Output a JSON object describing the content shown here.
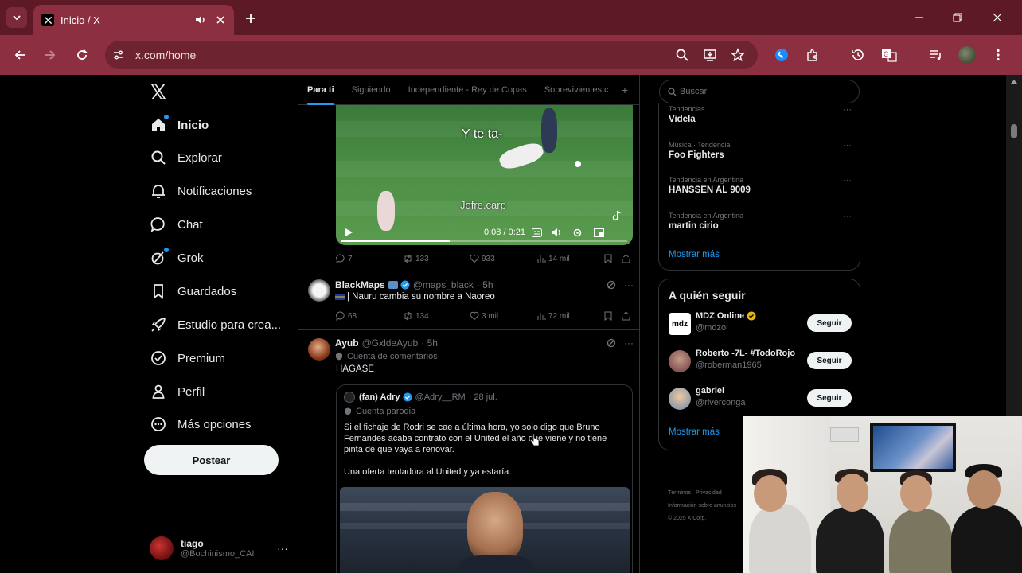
{
  "browser": {
    "tab_title": "Inicio / X",
    "url": "x.com/home"
  },
  "sidebar": {
    "items": [
      {
        "label": "Inicio",
        "icon": "home-icon"
      },
      {
        "label": "Explorar",
        "icon": "search-icon"
      },
      {
        "label": "Notificaciones",
        "icon": "bell-icon"
      },
      {
        "label": "Chat",
        "icon": "chat-bubble-icon"
      },
      {
        "label": "Grok",
        "icon": "grok-icon"
      },
      {
        "label": "Guardados",
        "icon": "bookmark-icon"
      },
      {
        "label": "Estudio para crea...",
        "icon": "rocket-icon"
      },
      {
        "label": "Premium",
        "icon": "premium-icon"
      },
      {
        "label": "Perfil",
        "icon": "person-icon"
      },
      {
        "label": "Más opciones",
        "icon": "more-circle-icon"
      }
    ],
    "post_button": "Postear",
    "account": {
      "name": "tiago",
      "handle": "@Bochinismo_CAI"
    }
  },
  "timeline": {
    "tabs": [
      "Para ti",
      "Siguiendo",
      "Independiente - Rey de Copas",
      "Sobrevivientes c"
    ],
    "video": {
      "caption": "Y te ta-",
      "watermark": "Jofre.carp",
      "time": "0:08 / 0:21",
      "progress": 0.38,
      "stats": {
        "replies": "7",
        "reposts": "133",
        "likes": "933",
        "views": "14 mil"
      }
    },
    "tweets": [
      {
        "name": "BlackMaps",
        "handle": "@maps_black",
        "time": "· 5h",
        "text": "| Nauru cambia su nombre a Naoreo",
        "stats": {
          "replies": "68",
          "reposts": "134",
          "likes": "3 mil",
          "views": "72 mil"
        }
      },
      {
        "name": "Ayub",
        "handle": "@GxldeAyub",
        "time": "· 5h",
        "community": "Cuenta de comentarios",
        "text": "HAGASE",
        "quote": {
          "name": "(fan) Adry",
          "handle": "@Adry__RM",
          "time": "· 28 jul.",
          "community": "Cuenta parodia",
          "text": "Si el fichaje de Rodri se cae a última hora, yo solo digo que Bruno Fernandes acaba contrato con el United el año que viene y no tiene pinta de que vaya a renovar.",
          "text2": "Una oferta tentadora al United y ya estaría."
        }
      }
    ]
  },
  "right": {
    "search_placeholder": "Buscar",
    "trends": [
      {
        "meta": "Tendencias",
        "name": "Videla"
      },
      {
        "meta": "Música · Tendencia",
        "name": "Foo Fighters"
      },
      {
        "meta": "Tendencia en Argentina",
        "name": "HANSSEN AL 9009"
      },
      {
        "meta": "Tendencia en Argentina",
        "name": "martin cirio"
      }
    ],
    "show_more": "Mostrar más",
    "who_to_follow": {
      "title": "A quién seguir",
      "accounts": [
        {
          "name": "MDZ Online",
          "handle": "@mdzol",
          "button": "Seguir"
        },
        {
          "name": "Roberto -7L- #TodoRojo",
          "handle": "@roberman1965",
          "button": "Seguir"
        },
        {
          "name": "gabriel",
          "handle": "@riverconga",
          "button": "Seguir"
        }
      ],
      "show_more": "Mostrar más"
    },
    "footer": {
      "terms": "Términos",
      "privacy": "Privacidad",
      "ads": "Información sobre anuncios",
      "copyright": "© 2025 X Corp."
    }
  },
  "colors": {
    "accent": "#1d9bf0",
    "browser_frame": "#8c2f40",
    "browser_titlebar": "#5d1a26"
  }
}
